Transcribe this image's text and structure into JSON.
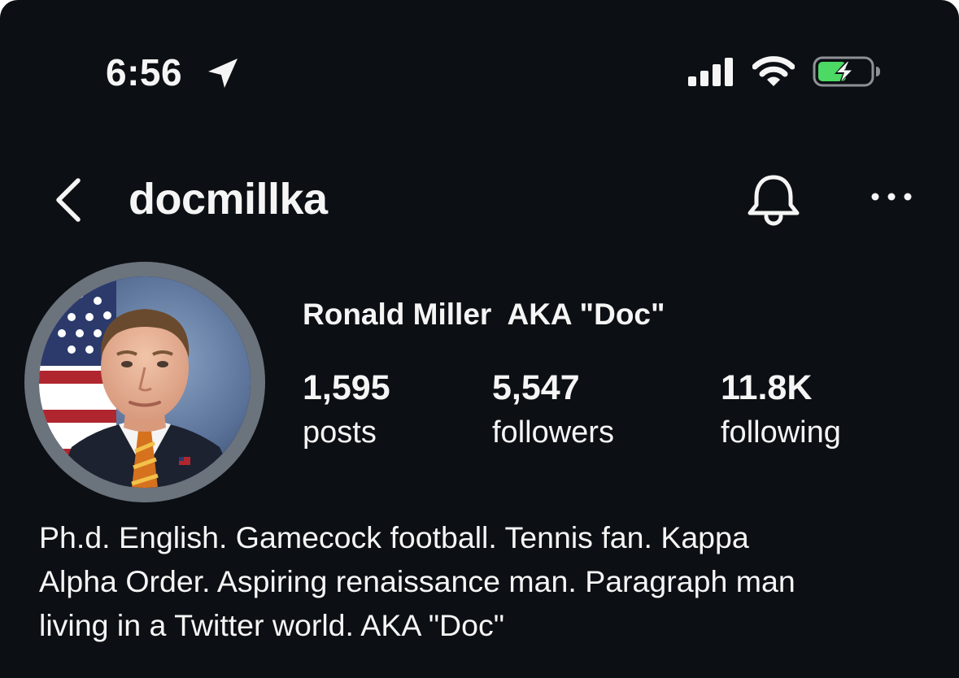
{
  "status_bar": {
    "time": "6:56",
    "location_icon": "location-arrow-icon",
    "signal_icon": "cellular-signal-icon",
    "wifi_icon": "wifi-icon",
    "battery_icon": "battery-charging-icon",
    "battery_color": "#4cd964"
  },
  "header": {
    "back_icon": "chevron-left-icon",
    "username": "docmillka",
    "notification_icon": "bell-icon",
    "more_icon": "more-horizontal-icon"
  },
  "profile": {
    "avatar_ring_color": "#6b737d",
    "display_name": "Ronald Miller  AKA \"Doc\"",
    "stats": [
      {
        "value": "1,595",
        "label": "posts"
      },
      {
        "value": "5,547",
        "label": "followers"
      },
      {
        "value": "11.8K",
        "label": "following"
      }
    ],
    "bio": "Ph.d. English. Gamecock football. Tennis fan. Kappa\nAlpha Order. Aspiring renaissance man. Paragraph man\nliving in a Twitter world. AKA \"Doc\""
  },
  "colors": {
    "background": "#0c0f13",
    "text": "#f5f5f5"
  }
}
